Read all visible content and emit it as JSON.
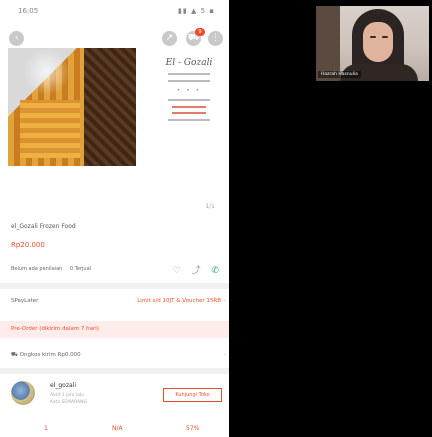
{
  "status_bar": {
    "time": "16:05",
    "icons": "▮▮ ▲ 5 ▪"
  },
  "header": {
    "back_icon": "‹",
    "cart_badge": "9"
  },
  "brand_card": {
    "logo": "El - Gozali"
  },
  "gallery": {
    "page_indicator": "1/1"
  },
  "product": {
    "title": "el_Gozali Frozen Food",
    "price": "Rp20.000",
    "rating_text": "Belum ada penilaian",
    "sold_text": "0 Terjual"
  },
  "spaylater": {
    "label": "SPayLater",
    "offer": "Limit s/d 10JT & Voucher 15RB"
  },
  "preorder": {
    "text": "Pre-Order (dikirim dalam 7 hari)"
  },
  "shipping": {
    "text": "Ongkos kirim Rp0.000"
  },
  "shop": {
    "name": "el_gozali",
    "status": "Aktif 1 jam lalu",
    "location": "Kota SEMARANG",
    "visit_button": "Kunjungi Toko"
  },
  "stats": {
    "products": "1",
    "rating": "N/A",
    "chat_performance": "57%"
  },
  "video_call": {
    "participant_name": "Hazrah Hasnulia"
  },
  "colors": {
    "accent": "#ee4d2d",
    "whatsapp": "#2fae5b"
  }
}
